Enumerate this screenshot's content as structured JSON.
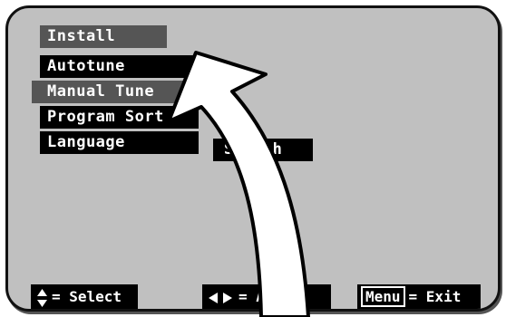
{
  "menu": {
    "title": "Install",
    "items": [
      {
        "label": "Autotune"
      },
      {
        "label": "Manual Tune"
      },
      {
        "label": "Program Sort"
      },
      {
        "label": "Language"
      }
    ],
    "selected_index": 1
  },
  "submenu": {
    "partial_label": "Search"
  },
  "footer": {
    "select_label": "= Select",
    "adjust_label": "= Adjust",
    "menu_key": "Menu",
    "exit_label": "= Exit"
  },
  "colors": {
    "screen_bg": "#c0c0c0",
    "bar_black": "#000000",
    "bar_highlight": "#555555",
    "text": "#ffffff",
    "arrow_fill": "#ffffff",
    "arrow_outline": "#000000"
  },
  "icons": {
    "select": "up-down-triangle-icon",
    "adjust": "left-right-triangle-icon",
    "overlay": "curved-arrow-icon"
  }
}
